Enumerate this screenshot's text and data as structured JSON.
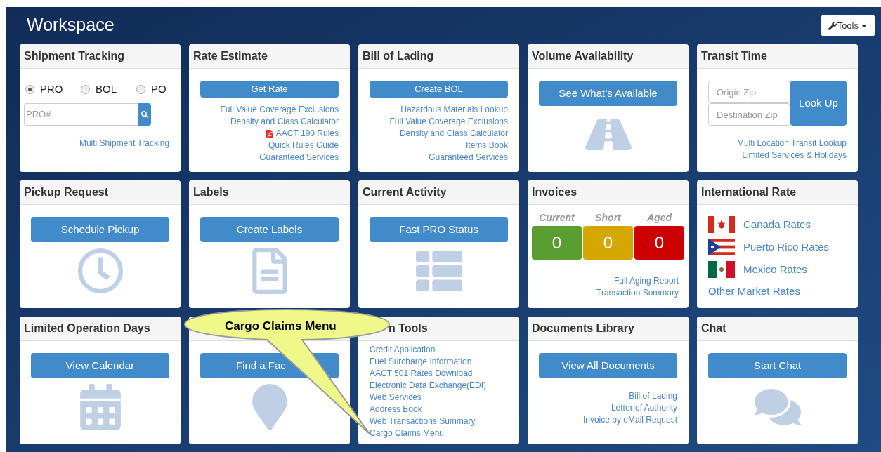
{
  "header": {
    "title": "Workspace",
    "tools_button": "Tools"
  },
  "cards": [
    {
      "kind": "tracking",
      "title": "Shipment Tracking",
      "radios": [
        {
          "label": "PRO",
          "selected": true
        },
        {
          "label": "BOL",
          "selected": false
        },
        {
          "label": "PO",
          "selected": false
        }
      ],
      "placeholder": "PRO#",
      "links": [
        {
          "label": "Multi Shipment Tracking",
          "kind": "link"
        }
      ]
    },
    {
      "kind": "links",
      "title": "Rate Estimate",
      "button": "Get Rate",
      "links": [
        {
          "label": "Full Value Coverage Exclusions",
          "kind": "link"
        },
        {
          "label": "Density and Class Calculator",
          "kind": "link"
        },
        {
          "label": "AACT 190 Rules",
          "kind": "pdf"
        },
        {
          "label": "Quick Rules Guide",
          "kind": "link"
        },
        {
          "label": "Guaranteed Services",
          "kind": "link"
        }
      ]
    },
    {
      "kind": "links",
      "title": "Bill of Lading",
      "button": "Create BOL",
      "links": [
        {
          "label": "Hazardous Materials Lookup",
          "kind": "link"
        },
        {
          "label": "Full Value Coverage Exclusions",
          "kind": "link"
        },
        {
          "label": "Density and Class Calculator",
          "kind": "link"
        },
        {
          "label": "Items Book",
          "kind": "link"
        },
        {
          "label": "Guaranteed Services",
          "kind": "link"
        }
      ]
    },
    {
      "kind": "action",
      "title": "Volume Availability",
      "button": "See What’s Available"
    },
    {
      "kind": "transit",
      "title": "Transit Time",
      "fields": [
        {
          "placeholder": "Origin Zip"
        },
        {
          "placeholder": "Destination Zip"
        }
      ],
      "button": "Look Up",
      "links": [
        {
          "label": "Multi Location Transit Lookup",
          "kind": "link"
        },
        {
          "label": "Limited Services & Holidays",
          "kind": "link"
        }
      ]
    },
    {
      "kind": "action",
      "title": "Pickup Request",
      "button": "Schedule Pickup"
    },
    {
      "kind": "action",
      "title": "Labels",
      "button": "Create Labels"
    },
    {
      "kind": "action",
      "title": "Current Activity",
      "button": "Fast PRO Status"
    },
    {
      "kind": "invoices",
      "title": "Invoices",
      "counters": [
        {
          "label": "Current",
          "value": "0",
          "color": "#5a9e32"
        },
        {
          "label": "Short",
          "value": "0",
          "color": "#d4a800"
        },
        {
          "label": "Aged",
          "value": "0",
          "color": "#cc0000"
        }
      ],
      "links": [
        {
          "label": "Full Aging Report",
          "kind": "link"
        },
        {
          "label": "Transaction Summary",
          "kind": "link"
        }
      ]
    },
    {
      "kind": "international",
      "title": "International Rate",
      "rates": [
        {
          "label": "Canada Rates"
        },
        {
          "label": "Puerto Rico Rates"
        },
        {
          "label": "Mexico Rates"
        }
      ],
      "other_link": "Other Market Rates"
    },
    {
      "kind": "action",
      "title": "Limited Operation Days",
      "button": "View Calendar"
    },
    {
      "kind": "action",
      "button": "Find a Fac"
    },
    {
      "kind": "menu",
      "title": "n Tools",
      "links": [
        {
          "label": "Credit Application",
          "kind": "link"
        },
        {
          "label": "Fuel Surcharge Information",
          "kind": "link"
        },
        {
          "label": "AACT 501 Rates Download",
          "kind": "link"
        },
        {
          "label": "Electronic Data Exchange(EDI)",
          "kind": "link"
        },
        {
          "label": "Web Services",
          "kind": "link"
        },
        {
          "label": "Address Book",
          "kind": "link"
        },
        {
          "label": "Web Transactions Summary",
          "kind": "link"
        },
        {
          "label": "Cargo Claims Menu",
          "kind": "link"
        }
      ]
    },
    {
      "kind": "action",
      "title": "Documents Library",
      "button": "View All Documents",
      "links": [
        {
          "label": "Bill of Lading",
          "kind": "link"
        },
        {
          "label": "Letter of Authority",
          "kind": "link"
        },
        {
          "label": "Invoice by eMail Request",
          "kind": "link"
        }
      ]
    },
    {
      "kind": "action",
      "title": "Chat",
      "button": "Start Chat"
    }
  ],
  "callout": {
    "text": "Cargo Claims Menu"
  }
}
